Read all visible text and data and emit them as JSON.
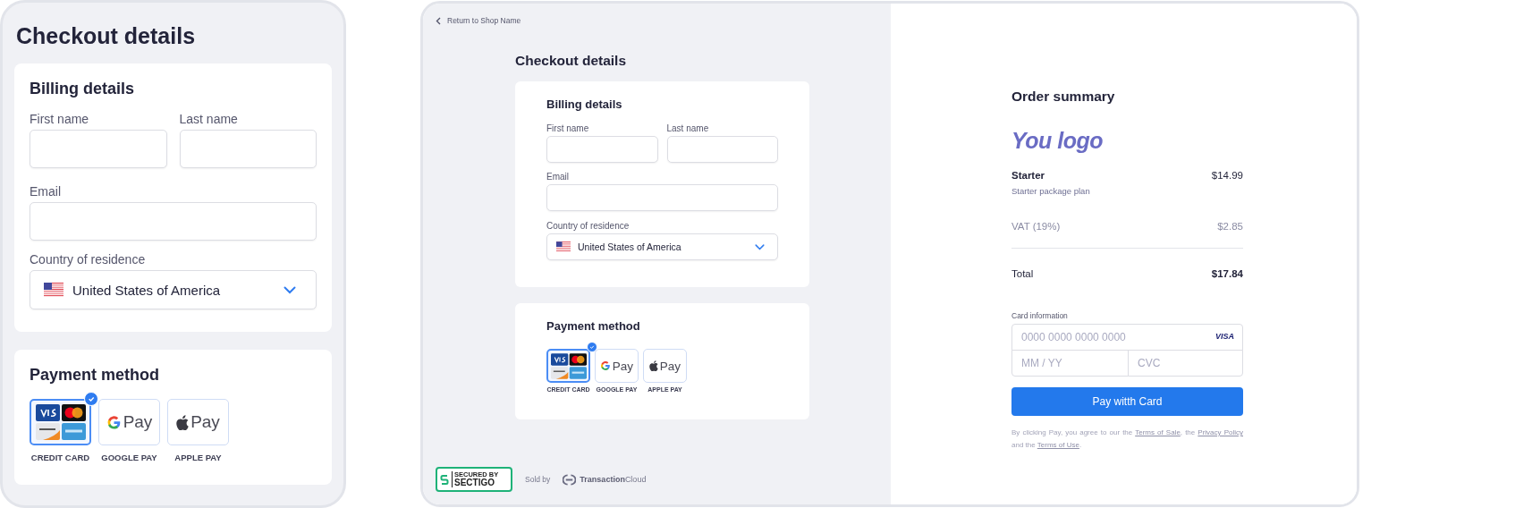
{
  "mobile_view": {
    "title": "Checkout details",
    "billing": {
      "heading": "Billing details",
      "name_fields": [
        {
          "label": "First name"
        },
        {
          "label": "Last name"
        }
      ],
      "email": {
        "label": "Email"
      },
      "country": {
        "label": "Country of residence",
        "value": "United States of America"
      }
    },
    "payment": {
      "heading": "Payment method",
      "methods": [
        {
          "kind": "card",
          "label": "CREDIT CARD",
          "selected": true
        },
        {
          "kind": "google",
          "label": "GOOGLE PAY",
          "mark": "Pay",
          "selected": false
        },
        {
          "kind": "apple",
          "label": "APPLE PAY",
          "mark": "Pay",
          "selected": false
        }
      ]
    }
  },
  "desktop_view": {
    "back_link": "Return to Shop Name",
    "title": "Checkout details",
    "billing": {
      "heading": "Billing details",
      "name_fields": [
        {
          "label": "First name"
        },
        {
          "label": "Last name"
        }
      ],
      "email": {
        "label": "Email"
      },
      "country": {
        "label": "Country of residence",
        "value": "United States of America"
      }
    },
    "payment": {
      "heading": "Payment method",
      "methods": [
        {
          "kind": "card",
          "label": "CREDIT CARD",
          "selected": true
        },
        {
          "kind": "google",
          "label": "GOOGLE PAY",
          "mark": "Pay",
          "selected": false
        },
        {
          "kind": "apple",
          "label": "APPLE PAY",
          "mark": "Pay",
          "selected": false
        }
      ]
    },
    "footer": {
      "badge_top": "SECURED BY",
      "badge_name": "SECTIGO",
      "sold_by": "Sold by",
      "seller": "**Transaction**Cloud"
    },
    "order": {
      "heading": "Order summary",
      "logo": "You logo",
      "items": [
        {
          "name": "Starter",
          "price": "$14.99",
          "description": "Starter package plan"
        }
      ],
      "tax": {
        "label": "VAT (19%)",
        "amount": "$2.85"
      },
      "total": {
        "label": "Total",
        "amount": "$17.84"
      },
      "card": {
        "label": "Card information",
        "number_placeholder": "0000 0000 0000 0000",
        "brand": "VISA",
        "expiry_placeholder": "MM / YY",
        "cvc_placeholder": "CVC"
      },
      "pay_button": "Pay witth Card",
      "terms": [
        {
          "kind": "text",
          "text": "By clicking Pay, you agree to our the "
        },
        {
          "kind": "link",
          "text": "Terms of Sale"
        },
        {
          "kind": "text",
          "text": ", the "
        },
        {
          "kind": "link",
          "text": "Privacy Policy"
        },
        {
          "kind": "text",
          "text": " and the "
        },
        {
          "kind": "link",
          "text": "Terms of Use"
        },
        {
          "kind": "text",
          "text": "."
        }
      ]
    }
  }
}
